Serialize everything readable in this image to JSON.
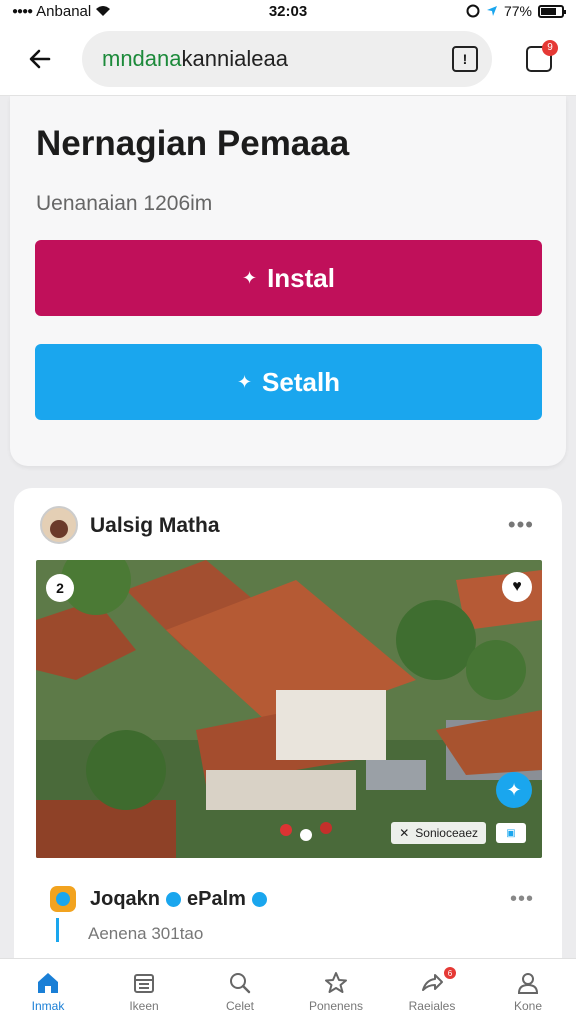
{
  "status_bar": {
    "carrier": "Anbanal",
    "time": "32:03",
    "battery": "77%"
  },
  "app_bar": {
    "url_green": "mndana",
    "url_dark": "kannialeaa",
    "url_icon": "!",
    "notification_count": "9"
  },
  "app": {
    "title": "Nernagian Pemaaa",
    "subtitle": "Uenanaian 1206im",
    "install_label": "Instal",
    "second_label": "Setalh"
  },
  "post": {
    "author": "Ualsig Matha",
    "menu": "•••",
    "image_badge_left": "2",
    "image_caption": "Sonioceaez",
    "sub_name_1": "Joqakn",
    "sub_name_2": "ePalm",
    "sub_menu": "•••",
    "sub_text": "Aenena 301tao"
  },
  "nav": {
    "items": [
      {
        "label": "Inmak",
        "icon": "home-icon"
      },
      {
        "label": "Ikeen",
        "icon": "calendar-icon"
      },
      {
        "label": "Celet",
        "icon": "search-icon"
      },
      {
        "label": "Ponenens",
        "icon": "star-icon"
      },
      {
        "label": "Raeiales",
        "icon": "share-icon",
        "badge": "6"
      },
      {
        "label": "Kone",
        "icon": "profile-icon"
      }
    ]
  },
  "colors": {
    "install_button": "#c0105a",
    "second_button": "#1aa6ee",
    "accent": "#1a7fd6"
  }
}
